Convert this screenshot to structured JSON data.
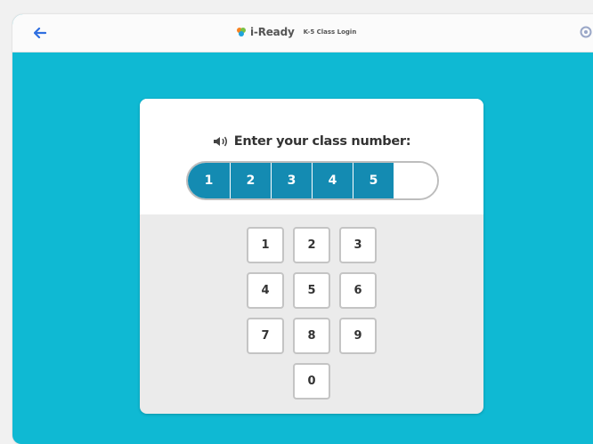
{
  "header": {
    "brand_name": "i-Ready",
    "brand_sub": "K-5 Class Login",
    "icons": {
      "back": "arrow-left-icon",
      "logo": "iready-logo-icon",
      "settings": "gear-icon"
    }
  },
  "login": {
    "prompt": "Enter your class number:",
    "speaker_icon": "speaker-icon",
    "entered_digits": [
      "1",
      "2",
      "3",
      "4",
      "5"
    ],
    "keypad": [
      "1",
      "2",
      "3",
      "4",
      "5",
      "6",
      "7",
      "8",
      "9",
      "0"
    ]
  },
  "colors": {
    "background": "#0fb9d3",
    "digit_fill": "#148bb2"
  }
}
